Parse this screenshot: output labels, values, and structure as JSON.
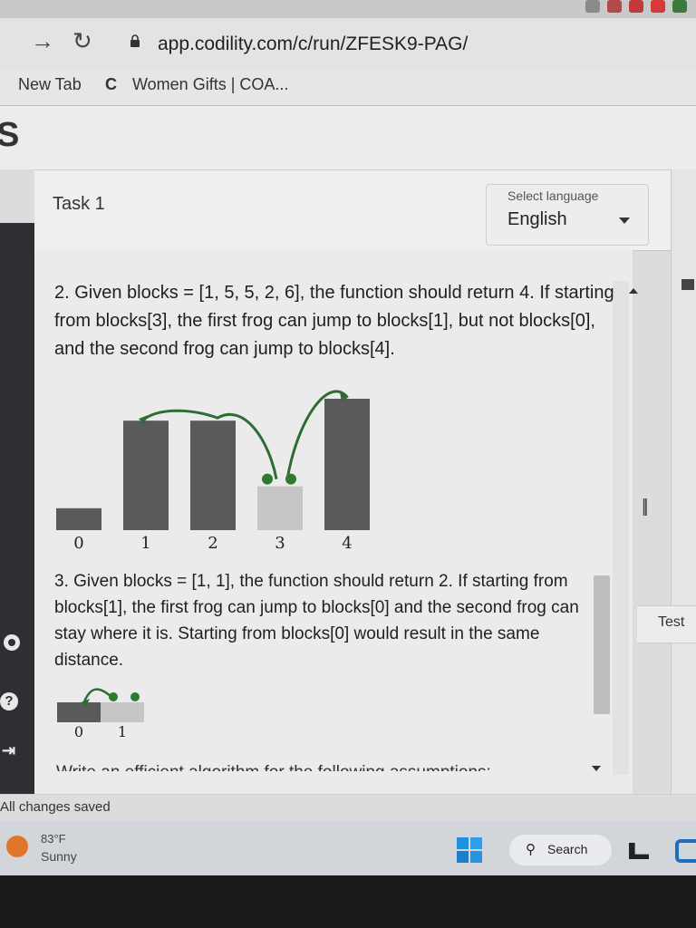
{
  "browser": {
    "url": "app.codility.com/c/run/ZFESK9-PAG/",
    "bookmarks": [
      "New Tab",
      "Women Gifts | COA..."
    ]
  },
  "app": {
    "logo_letter": "S",
    "task_title": "Task 1",
    "language": {
      "label": "Select language",
      "value": "English"
    },
    "status": "All changes saved",
    "right_tab": "Test"
  },
  "examples": [
    {
      "text": "2. Given blocks = [1, 5, 5, 2, 6], the function should return 4. If starting from blocks[3], the first frog can jump to blocks[1], but not blocks[0], and the second frog can jump to blocks[4].",
      "chart_data": {
        "type": "bar",
        "categories": [
          "0",
          "1",
          "2",
          "3",
          "4"
        ],
        "values": [
          1,
          5,
          5,
          2,
          6
        ],
        "highlight_index": 3,
        "ylim": [
          0,
          6
        ]
      }
    },
    {
      "text": "3. Given blocks = [1, 1], the function should return 2. If starting from blocks[1], the first frog can jump to blocks[0] and the second frog can stay where it is. Starting from blocks[0] would result in the same distance.",
      "chart_data": {
        "type": "bar",
        "categories": [
          "0",
          "1"
        ],
        "values": [
          1,
          1
        ],
        "highlight_index": 1,
        "ylim": [
          0,
          1
        ]
      }
    }
  ],
  "cutoff_text": "Write an efficient algorithm for the following assumptions:",
  "taskbar": {
    "temperature": "83°F",
    "condition": "Sunny",
    "search_label": "Search"
  },
  "colors": {
    "bar_dark": "#5a5a5a",
    "bar_highlight": "#c6c6c6",
    "frog_path": "#2f6b35",
    "frog_dot": "#2e7a31"
  }
}
